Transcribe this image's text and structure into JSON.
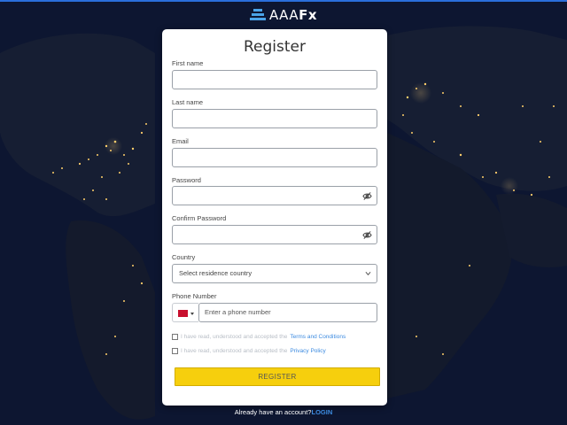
{
  "brand": {
    "logo_text_light": "AAA",
    "logo_text_bold": "Fx",
    "accent_color": "#2a6fdb"
  },
  "form": {
    "title": "Register",
    "first_name": {
      "label": "First name",
      "value": ""
    },
    "last_name": {
      "label": "Last name",
      "value": ""
    },
    "email": {
      "label": "Email",
      "value": ""
    },
    "password": {
      "label": "Password",
      "value": "",
      "icon": "eye-slash-icon"
    },
    "confirm_password": {
      "label": "Confirm Password",
      "value": "",
      "icon": "eye-slash-icon"
    },
    "country": {
      "label": "Country",
      "selected": "Select residence country"
    },
    "phone": {
      "label": "Phone Number",
      "placeholder": "Enter a phone number",
      "flag_color": "#c8102e"
    },
    "terms": {
      "prefix": "I have read, understood and accepted the ",
      "link": "Terms and Conditions"
    },
    "privacy": {
      "prefix": "I have read, understood and accepted the ",
      "link": "Privacy Policy"
    },
    "submit_label": "REGISTER",
    "submit_color": "#f6cf0d"
  },
  "footer": {
    "prompt": "Already have an account?",
    "login_label": "LOGIN"
  }
}
